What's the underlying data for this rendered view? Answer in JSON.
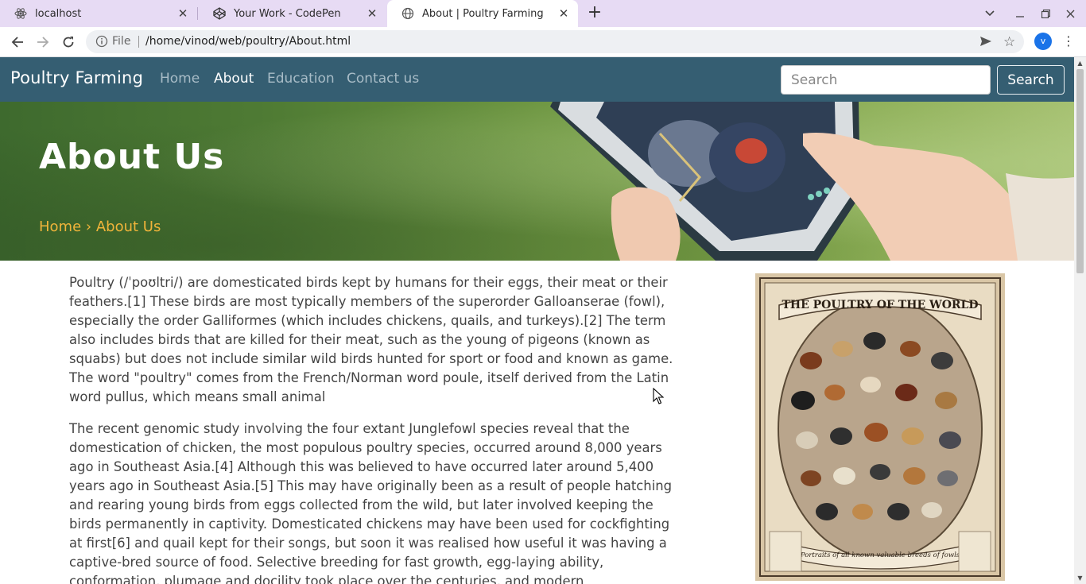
{
  "browser": {
    "tabs": [
      {
        "label": "localhost",
        "icon": "react-icon"
      },
      {
        "label": "Your Work - CodePen",
        "icon": "codepen-icon"
      },
      {
        "label": "About | Poultry Farming",
        "icon": "globe-icon"
      }
    ],
    "omnibox": {
      "scheme_label": "File",
      "url": "/home/vinod/web/poultry/About.html"
    },
    "profile_initial": "v"
  },
  "site": {
    "brand": "Poultry Farming",
    "nav": [
      "Home",
      "About",
      "Education",
      "Contact us"
    ],
    "active_nav": "About",
    "search": {
      "placeholder": "Search",
      "button_label": "Search"
    }
  },
  "hero": {
    "title": "About Us",
    "breadcrumb": {
      "home": "Home",
      "separator": "›",
      "current": "About Us"
    }
  },
  "content": {
    "paragraphs": [
      "Poultry (/ˈpoʊltri/) are domesticated birds kept by humans for their eggs, their meat or their feathers.[1] These birds are most typically members of the superorder Galloanserae (fowl), especially the order Galliformes (which includes chickens, quails, and turkeys).[2] The term also includes birds that are killed for their meat, such as the young of pigeons (known as squabs) but does not include similar wild birds hunted for sport or food and known as game. The word \"poultry\" comes from the French/Norman word poule, itself derived from the Latin word pullus, which means small animal",
      "The recent genomic study involving the four extant Junglefowl species reveal that the domestication of chicken, the most populous poultry species, occurred around 8,000 years ago in Southeast Asia.[4] Although this was believed to have occurred later around 5,400 years ago in Southeast Asia.[5] This may have originally been as a result of people hatching and rearing young birds from eggs collected from the wild, but later involved keeping the birds permanently in captivity. Domesticated chickens may have been used for cockfighting at first[6] and quail kept for their songs, but soon it was realised how useful it was having a captive-bred source of food. Selective breeding for fast growth, egg-laying ability, conformation, plumage and docility took place over the centuries, and modern"
    ],
    "poster": {
      "title": "THE POULTRY OF THE WORLD",
      "caption": "Portraits of all known valuable breeds of fowls"
    }
  },
  "colors": {
    "nav_bg": "#355e72",
    "breadcrumb": "#f0b43a",
    "tabbar": "#e7dbf4"
  }
}
